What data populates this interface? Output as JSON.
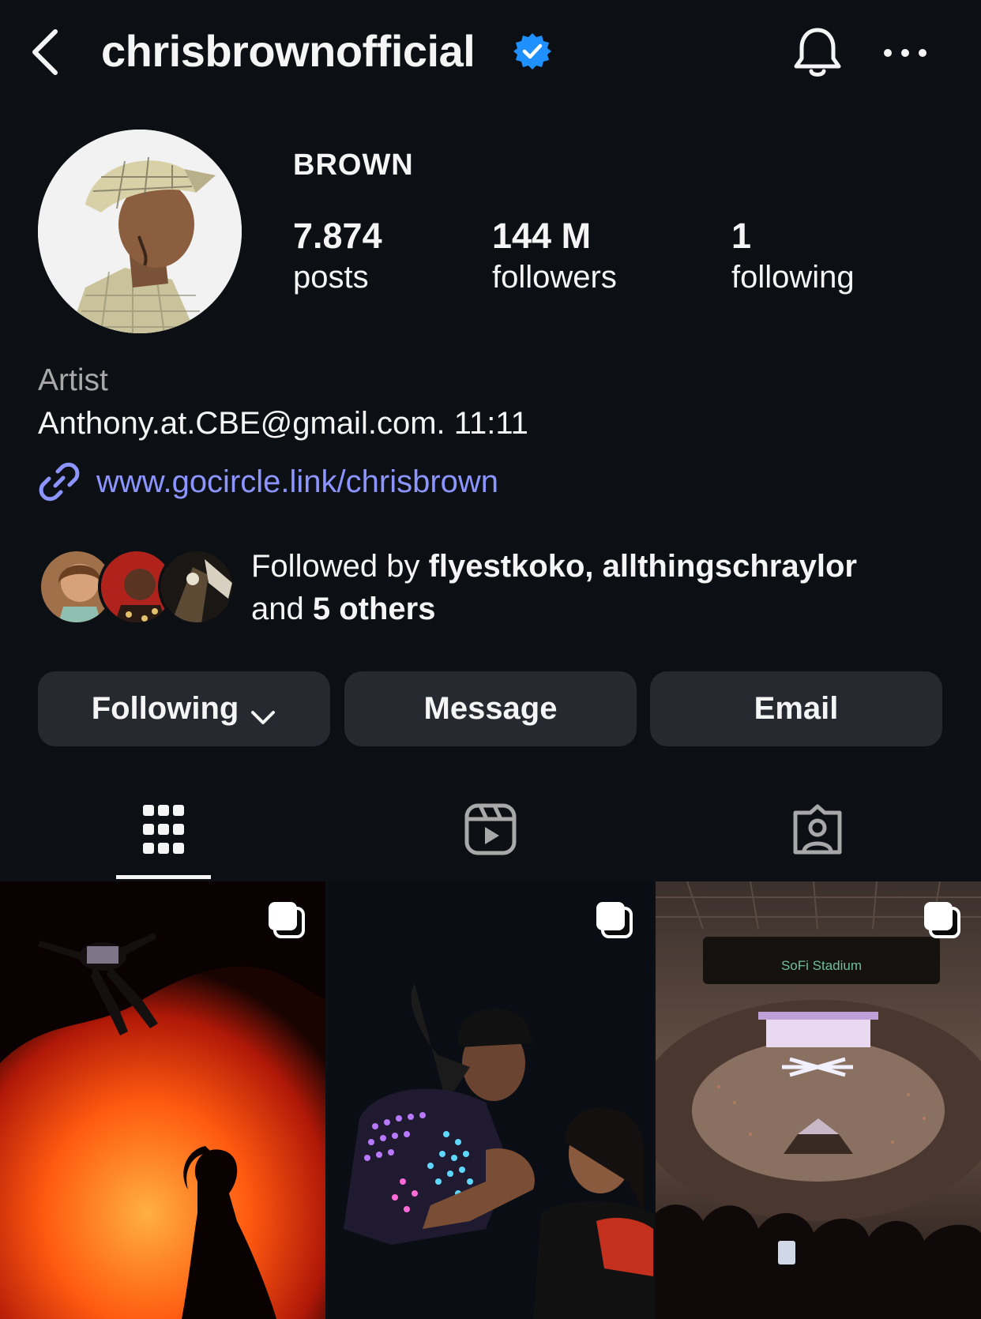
{
  "header": {
    "username": "chrisbrownofficial",
    "verified": true,
    "icons": [
      "back-arrow-icon",
      "verified-badge-icon",
      "bell-icon",
      "more-icon"
    ]
  },
  "profile": {
    "display_name": "BROWN",
    "stats": [
      {
        "value": "7.874",
        "label": "posts"
      },
      {
        "value": "144 M",
        "label": "followers"
      },
      {
        "value": "1",
        "label": "following"
      }
    ],
    "category": "Artist",
    "bio": "Anthony.at.CBE@gmail.com. 11:11",
    "link": "www.gocircle.link/chrisbrown"
  },
  "mutuals": {
    "prefix": "Followed by ",
    "names": "flyestkoko, allthingschraylor",
    "middle": "and ",
    "others": "5 others"
  },
  "actions": {
    "following": "Following",
    "message": "Message",
    "email": "Email"
  },
  "tabs": [
    "posts-grid-icon",
    "reels-icon",
    "tagged-icon"
  ],
  "posts": [
    {
      "image": "fire-performance",
      "multiple": true
    },
    {
      "image": "led-jacket-performance",
      "multiple": true
    },
    {
      "image": "stadium-crowd",
      "multiple": true,
      "sign_text": "SoFi Stadium"
    }
  ],
  "colors": {
    "background": "#0c1014",
    "button": "#262a30",
    "link": "#8c95ff",
    "verified": "#1e90ff",
    "muted_text": "#a8a8a8"
  }
}
